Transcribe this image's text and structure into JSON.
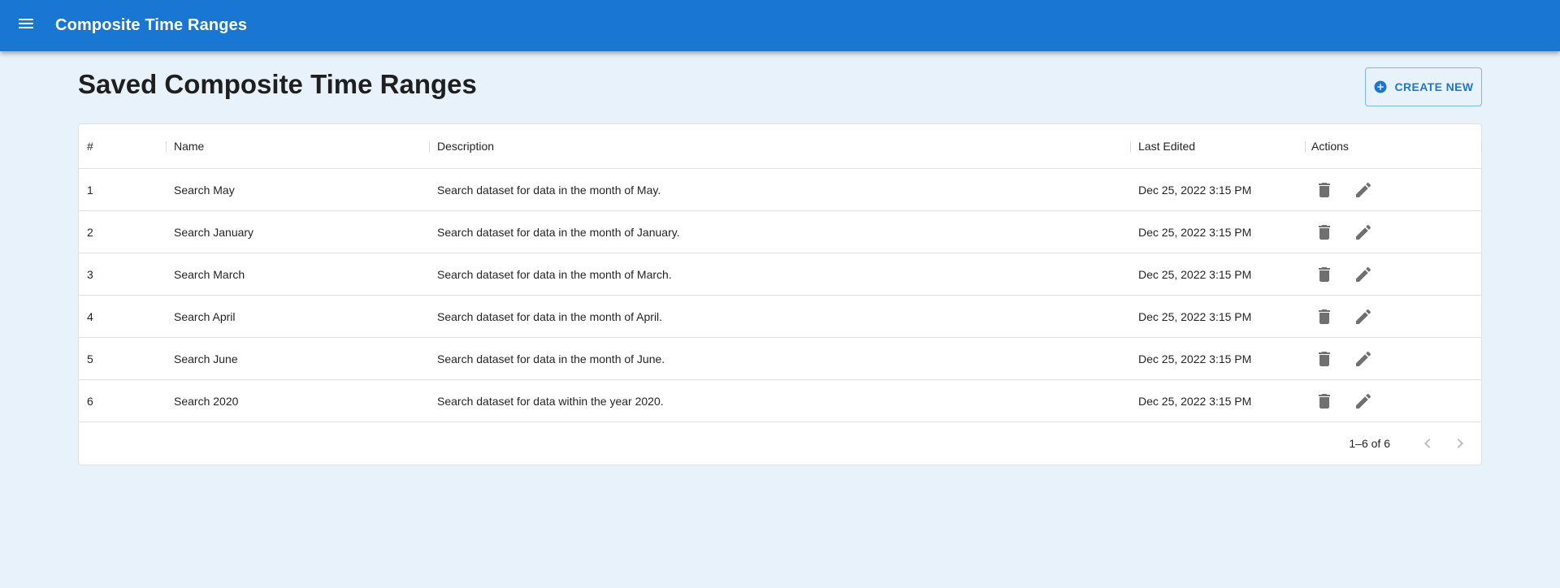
{
  "app": {
    "title": "Composite Time Ranges",
    "accent_color": "#1976d2",
    "menu_icon": "menu-icon"
  },
  "page": {
    "heading": "Saved Composite Time Ranges",
    "create_button": {
      "label": "CREATE NEW",
      "icon": "add-circle-icon"
    }
  },
  "table": {
    "columns": [
      "#",
      "Name",
      "Description",
      "Last Edited",
      "Actions"
    ],
    "rows": [
      {
        "num": "1",
        "name": "Search May",
        "description": "Search dataset for data in the month of May.",
        "last_edited": "Dec 25, 2022 3:15 PM"
      },
      {
        "num": "2",
        "name": "Search January",
        "description": "Search dataset for data in the month of January.",
        "last_edited": "Dec 25, 2022 3:15 PM"
      },
      {
        "num": "3",
        "name": "Search March",
        "description": "Search dataset for data in the month of March.",
        "last_edited": "Dec 25, 2022 3:15 PM"
      },
      {
        "num": "4",
        "name": "Search April",
        "description": "Search dataset for data in the month of April.",
        "last_edited": "Dec 25, 2022 3:15 PM"
      },
      {
        "num": "5",
        "name": "Search June",
        "description": "Search dataset for data in the month of June.",
        "last_edited": "Dec 25, 2022 3:15 PM"
      },
      {
        "num": "6",
        "name": "Search 2020",
        "description": "Search dataset for data within the year 2020.",
        "last_edited": "Dec 25, 2022 3:15 PM"
      }
    ],
    "row_actions": [
      "delete-icon",
      "edit-icon"
    ],
    "pagination": {
      "label": "1–6 of 6",
      "prev_icon": "chevron-left-icon",
      "next_icon": "chevron-right-icon"
    }
  }
}
